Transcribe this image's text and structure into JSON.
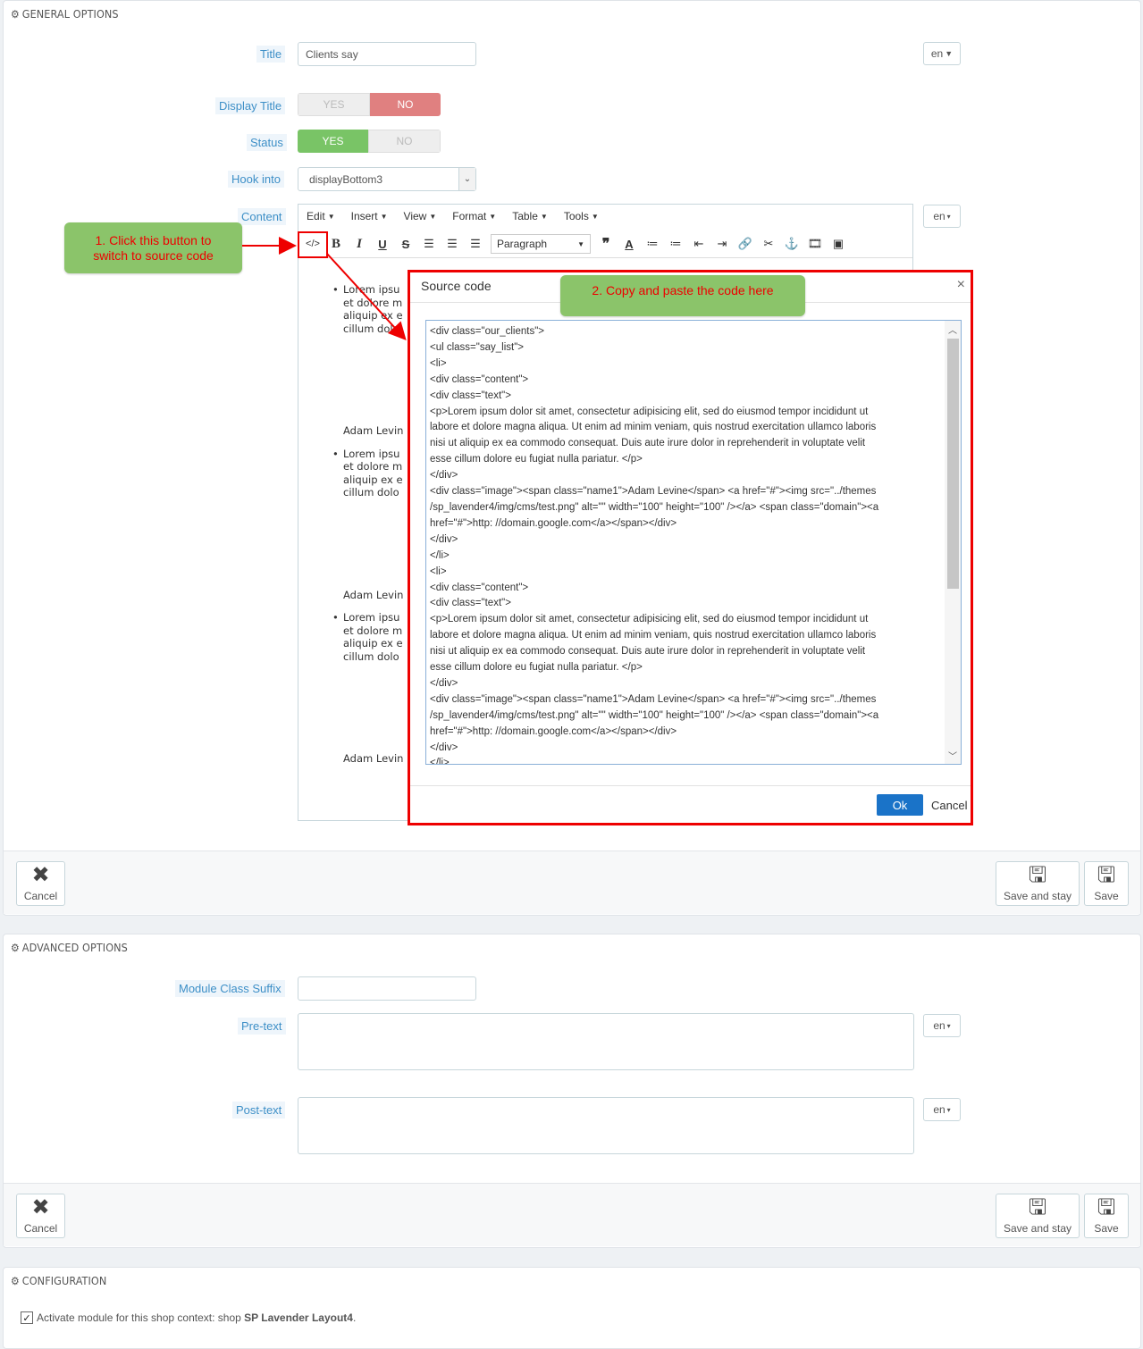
{
  "general": {
    "heading": "GENERAL OPTIONS",
    "title_label": "Title",
    "title_value": "Clients say",
    "lang": "en",
    "display_title_label": "Display Title",
    "status_label": "Status",
    "yes": "YES",
    "no": "NO",
    "display_title_value": "NO",
    "status_value": "YES",
    "hook_label": "Hook into",
    "hook_value": "displayBottom3",
    "content_label": "Content"
  },
  "editor": {
    "menu": [
      "Edit",
      "Insert",
      "View",
      "Format",
      "Table",
      "Tools"
    ],
    "paragraph": "Paragraph",
    "preview_lines": [
      "Lorem ipsu",
      "et dolore m",
      "aliquip ex e",
      "cillum dolo",
      "Adam Levin",
      "Lorem ipsu",
      "et dolore m",
      "aliquip ex e",
      "cillum dolo",
      "Adam Levin",
      "Lorem ipsu",
      "et dolore m",
      "aliquip ex e",
      "cillum dolo",
      "Adam Levin"
    ]
  },
  "dialog": {
    "title": "Source code",
    "close": "×",
    "ok": "Ok",
    "cancel": "Cancel",
    "code_lines": [
      "<div class=\"our_clients\">",
      "<ul class=\"say_list\">",
      "<li>",
      "<div class=\"content\">",
      "<div class=\"text\">",
      "<p>Lorem ipsum dolor sit amet, consectetur adipisicing elit, sed do eiusmod tempor incididunt ut",
      "labore et dolore magna aliqua. Ut enim ad minim veniam, quis nostrud exercitation ullamco laboris",
      "nisi ut aliquip ex ea commodo consequat. Duis aute irure dolor in reprehenderit in voluptate velit",
      "esse cillum dolore eu fugiat nulla pariatur. </p>",
      "</div>",
      "<div class=\"image\"><span class=\"name1\">Adam Levine</span> <a href=\"#\"><img src=\"../themes",
      "/sp_lavender4/img/cms/test.png\" alt=\"\" width=\"100\" height=\"100\" /></a> <span class=\"domain\"><a",
      "href=\"#\">http: //domain.google.com</a></span></div>",
      "</div>",
      "</li>",
      "<li>",
      "<div class=\"content\">",
      "<div class=\"text\">",
      "<p>Lorem ipsum dolor sit amet, consectetur adipisicing elit, sed do eiusmod tempor incididunt ut",
      "labore et dolore magna aliqua. Ut enim ad minim veniam, quis nostrud exercitation ullamco laboris",
      "nisi ut aliquip ex ea commodo consequat. Duis aute irure dolor in reprehenderit in voluptate velit",
      "esse cillum dolore eu fugiat nulla pariatur. </p>",
      "</div>",
      "<div class=\"image\"><span class=\"name1\">Adam Levine</span> <a href=\"#\"><img src=\"../themes",
      "/sp_lavender4/img/cms/test.png\" alt=\"\" width=\"100\" height=\"100\" /></a> <span class=\"domain\"><a",
      "href=\"#\">http: //domain.google.com</a></span></div>",
      "</div>",
      "</li>"
    ]
  },
  "callouts": {
    "step1": "1. Click this button to switch to source code",
    "step2": "2. Copy and paste the code here"
  },
  "footer": {
    "cancel": "Cancel",
    "save_and_stay": "Save and stay",
    "save": "Save"
  },
  "advanced": {
    "heading": "ADVANCED OPTIONS",
    "suffix_label": "Module Class Suffix",
    "pretext_label": "Pre-text",
    "posttext_label": "Post-text",
    "lang": "en"
  },
  "configuration": {
    "heading": "CONFIGURATION",
    "activate_text": "Activate module for this shop context: shop ",
    "shop_name": "SP Lavender Layout4",
    "suffix": "."
  },
  "colors": {
    "highlight": "#ee0000",
    "callout": "#8bc46a",
    "ok": "#1a73c8"
  }
}
